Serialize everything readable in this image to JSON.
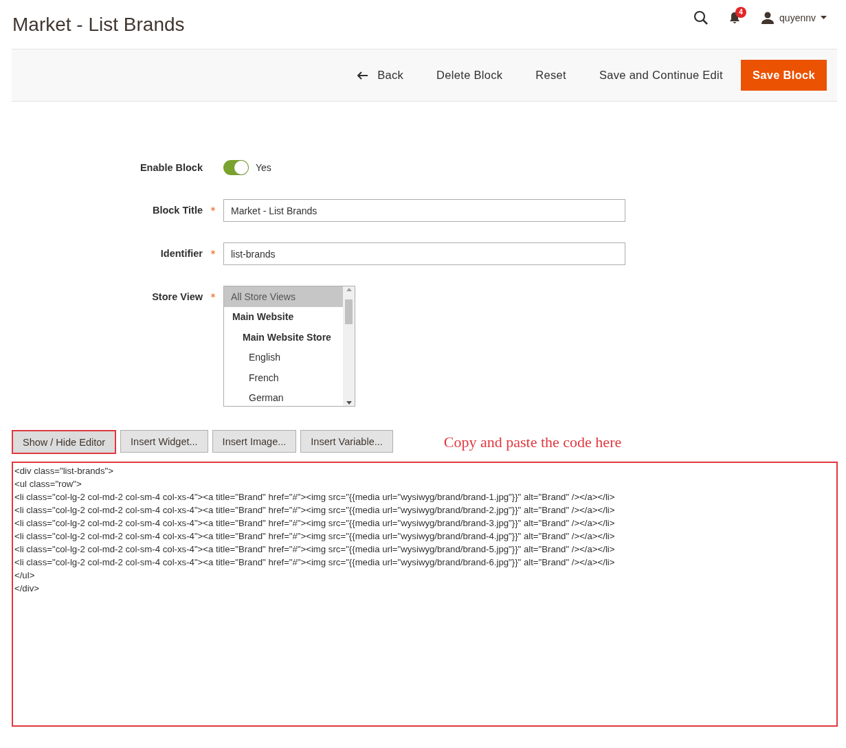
{
  "page_title": "Market - List Brands",
  "header": {
    "notification_count": "4",
    "user": "quyennv"
  },
  "toolbar": {
    "buttons": [
      {
        "label": "Back",
        "kind": "back"
      },
      {
        "label": "Delete Block",
        "kind": "plain"
      },
      {
        "label": "Reset",
        "kind": "plain"
      },
      {
        "label": "Save and Continue Edit",
        "kind": "plain"
      },
      {
        "label": "Save Block",
        "kind": "primary"
      }
    ]
  },
  "form": {
    "enable": {
      "label": "Enable Block",
      "on": true,
      "value": "Yes"
    },
    "fields": [
      {
        "label": "Block Title",
        "required_mark": "*",
        "value": "Market - List Brands"
      },
      {
        "label": "Identifier",
        "required_mark": "*",
        "value": "list-brands"
      }
    ],
    "store_view": {
      "label": "Store View",
      "required_mark": "*",
      "options": [
        {
          "label": "All Store Views",
          "kind": "option",
          "selected": true
        },
        {
          "label": "Main Website",
          "kind": "website",
          "selected": false
        },
        {
          "label": "Main Website Store",
          "kind": "store",
          "selected": false
        },
        {
          "label": "English",
          "kind": "option",
          "selected": false
        },
        {
          "label": "French",
          "kind": "option",
          "selected": false
        },
        {
          "label": "German",
          "kind": "option",
          "selected": false
        }
      ]
    }
  },
  "editor": {
    "buttons": [
      {
        "label": "Show / Hide Editor",
        "highlighted": true
      },
      {
        "label": "Insert Widget...",
        "highlighted": false
      },
      {
        "label": "Insert Image...",
        "highlighted": false
      },
      {
        "label": "Insert Variable...",
        "highlighted": false
      }
    ],
    "annotation": "Copy and paste the code here",
    "code_lines": [
      "<div class=\"list-brands\">",
      "<ul class=\"row\">",
      "<li class=\"col-lg-2 col-md-2 col-sm-4 col-xs-4\"><a title=\"Brand\" href=\"#\"><img src=\"{{media url=\"wysiwyg/brand/brand-1.jpg\"}}\" alt=\"Brand\" /></a></li>",
      "<li class=\"col-lg-2 col-md-2 col-sm-4 col-xs-4\"><a title=\"Brand\" href=\"#\"><img src=\"{{media url=\"wysiwyg/brand/brand-2.jpg\"}}\" alt=\"Brand\" /></a></li>",
      "<li class=\"col-lg-2 col-md-2 col-sm-4 col-xs-4\"><a title=\"Brand\" href=\"#\"><img src=\"{{media url=\"wysiwyg/brand/brand-3.jpg\"}}\" alt=\"Brand\" /></a></li>",
      "<li class=\"col-lg-2 col-md-2 col-sm-4 col-xs-4\"><a title=\"Brand\" href=\"#\"><img src=\"{{media url=\"wysiwyg/brand/brand-4.jpg\"}}\" alt=\"Brand\" /></a></li>",
      "<li class=\"col-lg-2 col-md-2 col-sm-4 col-xs-4\"><a title=\"Brand\" href=\"#\"><img src=\"{{media url=\"wysiwyg/brand/brand-5.jpg\"}}\" alt=\"Brand\" /></a></li>",
      "<li class=\"col-lg-2 col-md-2 col-sm-4 col-xs-4\"><a title=\"Brand\" href=\"#\"><img src=\"{{media url=\"wysiwyg/brand/brand-6.jpg\"}}\" alt=\"Brand\" /></a></li>",
      "</ul>",
      "</div>"
    ]
  }
}
